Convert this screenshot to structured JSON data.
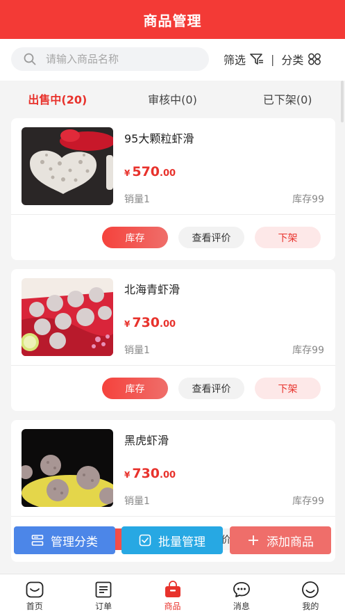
{
  "header": {
    "title": "商品管理"
  },
  "search": {
    "placeholder": "请输入商品名称"
  },
  "filter": {
    "filter_label": "筛选",
    "separator": "|",
    "category_label": "分类"
  },
  "tabs": [
    {
      "label": "出售中(20)",
      "active": true
    },
    {
      "label": "审核中(0)",
      "active": false
    },
    {
      "label": "已下架(0)",
      "active": false
    }
  ],
  "products": [
    {
      "name": "95大颗粒虾滑",
      "currency": "¥",
      "price_int": "570",
      "price_dec": ".00",
      "sales": "销量1",
      "stock": "库存99"
    },
    {
      "name": "北海青虾滑",
      "currency": "¥",
      "price_int": "730",
      "price_dec": ".00",
      "sales": "销量1",
      "stock": "库存99"
    },
    {
      "name": "黑虎虾滑",
      "currency": "¥",
      "price_int": "730",
      "price_dec": ".00",
      "sales": "销量1",
      "stock": "库存99"
    }
  ],
  "card_actions": {
    "stock": "库存",
    "review": "查看评价",
    "off_shelf": "下架"
  },
  "float_buttons": {
    "manage_category": "管理分类",
    "batch_manage": "批量管理",
    "add_product": "添加商品"
  },
  "tabbar": [
    {
      "label": "首页",
      "icon": "home-icon"
    },
    {
      "label": "订单",
      "icon": "order-icon"
    },
    {
      "label": "商品",
      "icon": "shopping-bag-icon",
      "active": true
    },
    {
      "label": "消息",
      "icon": "message-icon"
    },
    {
      "label": "我的",
      "icon": "profile-icon"
    }
  ],
  "colors": {
    "brand_red": "#f33a36",
    "price_red": "#e8322c",
    "blue": "#4c86e8",
    "cyan": "#27a8e3",
    "pink": "#ef6e6a"
  }
}
